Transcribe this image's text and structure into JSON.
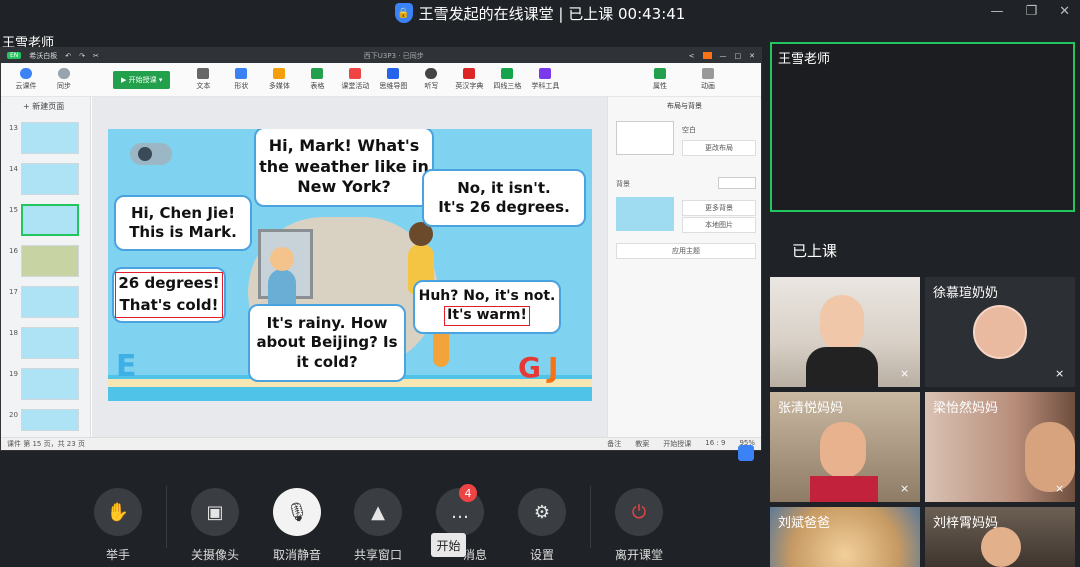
{
  "window": {
    "title": "王雪发起的在线课堂 | 已上课 00:43:41",
    "lock_icon": "lock-shield-icon"
  },
  "host_label": "王雪老师",
  "shared_app": {
    "mode_badge": "EN",
    "board_label": "希沃白板",
    "doc_title": "西下U3P3 · 已同步",
    "toolbar": {
      "cloud": "云课件",
      "sync": "同步",
      "start": "开始授课",
      "items": [
        "文本",
        "形状",
        "多媒体",
        "表格",
        "课堂活动",
        "思维导图",
        "听写",
        "英汉字典",
        "四线三格",
        "学科工具"
      ],
      "props": "属性",
      "anim": "动画"
    },
    "new_page": "新建页面",
    "thumb_numbers": [
      "13",
      "14",
      "15",
      "16",
      "17",
      "18",
      "19",
      "20"
    ],
    "slide": {
      "bubble1": "Hi, Mark! What's the weather like in New York?",
      "bubble2_line1": "No, it isn't.",
      "bubble2_line2": "It's 26 degrees.",
      "bubble3": "Hi, Chen Jie! This is Mark.",
      "bubble4_line1": "26 degrees!",
      "bubble4_line2": "That's cold!",
      "bubble5_pre": "Huh? No, it's not.",
      "bubble5_boxed": "It's warm!",
      "bubble6": "It's rainy. How about Beijing? Is it cold?"
    },
    "props_panel": {
      "title": "布局与背景",
      "blank": "空白",
      "change_layout": "更改布局",
      "background": "背景",
      "more_bg": "更多背景",
      "local_img": "本地图片",
      "apply_theme": "应用主题"
    },
    "status": {
      "page": "课件 第 15 页，共 23 页",
      "notes": "备注",
      "teach": "教案",
      "start_teach": "开始授课",
      "ratio": "16 : 9",
      "zoom": "95%"
    }
  },
  "controls": {
    "raise_hand": "举手",
    "camera_off": "关摄像头",
    "unmute": "取消静音",
    "share_window": "共享窗口",
    "messages": "消息",
    "message_count": "4",
    "settings": "设置",
    "leave": "离开课堂",
    "tooltip": "开始"
  },
  "right_panel": {
    "teacher_name": "王雪老师",
    "status": "已上课",
    "participants": [
      {
        "name": "",
        "muted": true
      },
      {
        "name": "徐慕瑄奶奶",
        "muted": true
      },
      {
        "name": "张清悦妈妈",
        "muted": true
      },
      {
        "name": "梁怡然妈妈",
        "muted": true
      },
      {
        "name": "刘斌爸爸",
        "muted": false
      },
      {
        "name": "刘梓霄妈妈",
        "muted": false
      }
    ]
  }
}
